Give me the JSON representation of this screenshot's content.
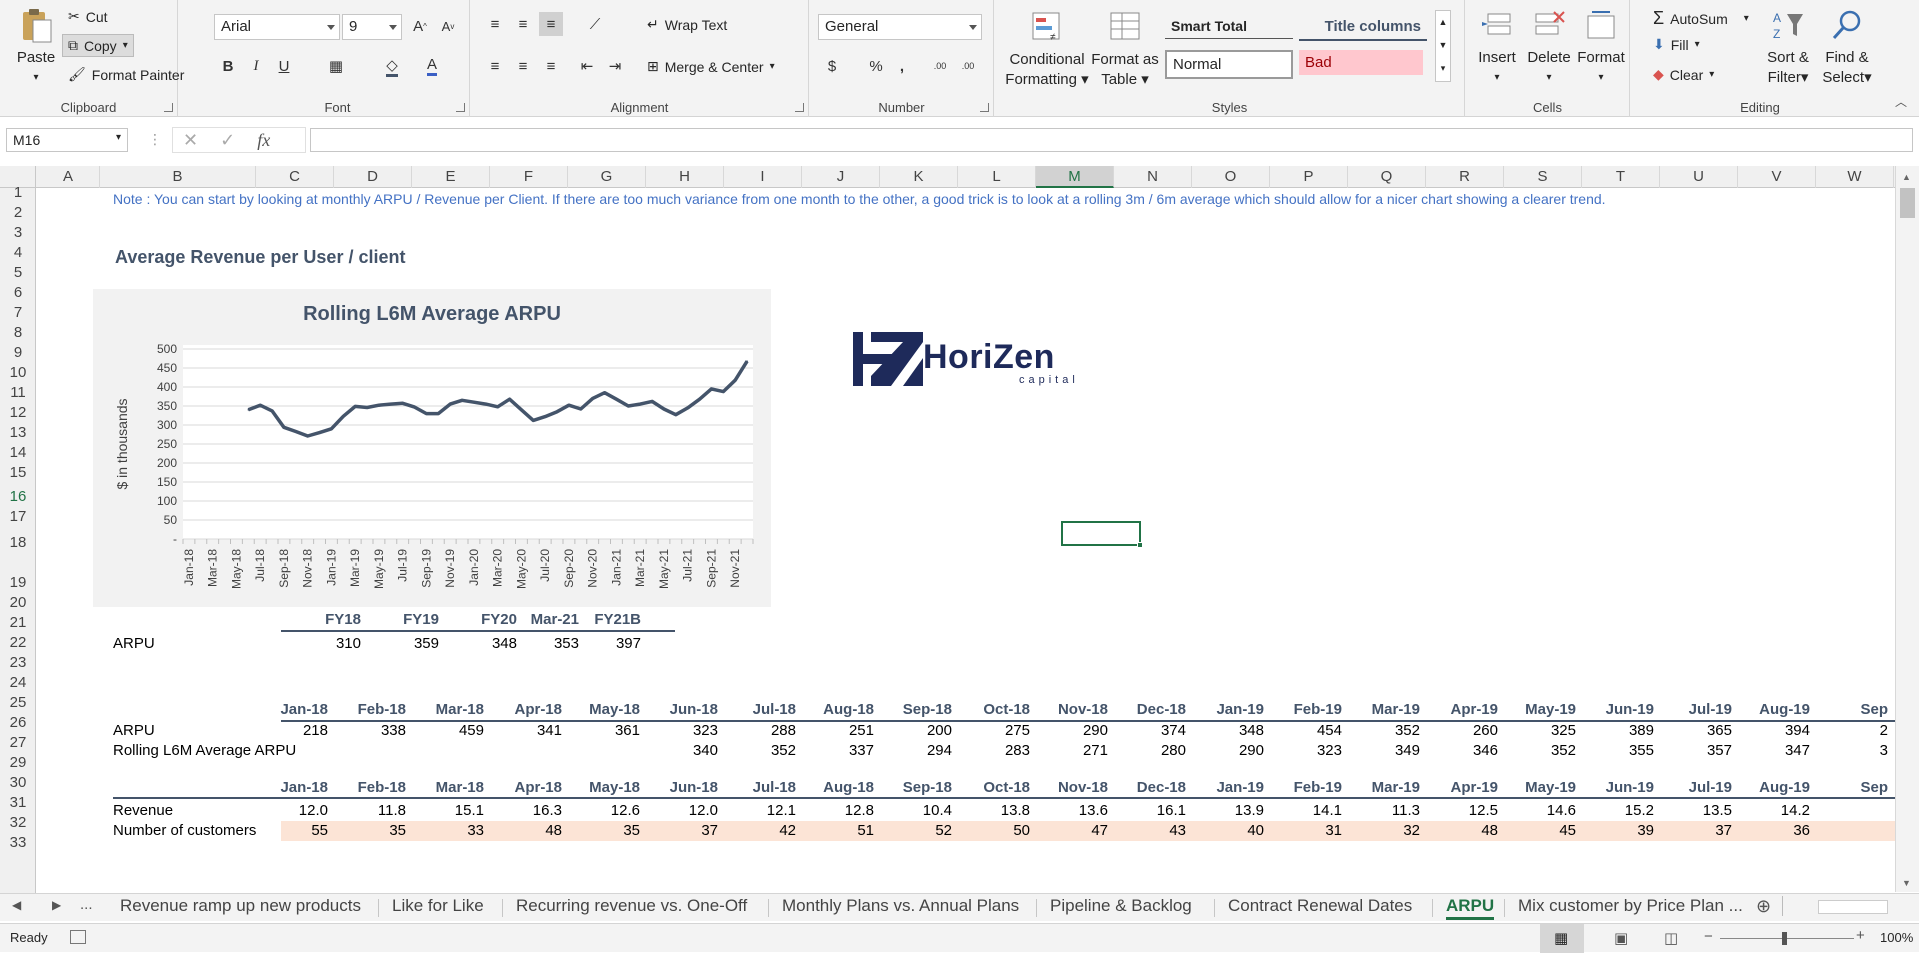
{
  "ribbon": {
    "clipboard": {
      "paste": "Paste",
      "cut": "Cut",
      "copy": "Copy",
      "format_painter": "Format Painter",
      "label": "Clipboard"
    },
    "font": {
      "name": "Arial",
      "size": "9",
      "label": "Font",
      "bold": "B",
      "italic": "I",
      "underline": "U",
      "grow": "A",
      "shrink": "A",
      "font_color": "A"
    },
    "alignment": {
      "wrap": "Wrap Text",
      "merge": "Merge & Center",
      "label": "Alignment"
    },
    "number": {
      "format": "General",
      "percent": "%",
      "comma": ",",
      "inc_decimal": ".00",
      "dec_decimal": ".00",
      "label": "Number"
    },
    "styles": {
      "conditional": "Conditional",
      "conditional2": "Formatting",
      "format_as": "Format as",
      "format_as2": "Table",
      "smart_total": "Smart Total",
      "title_columns": "Title columns",
      "normal": "Normal",
      "bad": "Bad",
      "label": "Styles"
    },
    "cells": {
      "insert": "Insert",
      "delete": "Delete",
      "format": "Format",
      "label": "Cells"
    },
    "editing": {
      "autosum": "AutoSum",
      "fill": "Fill",
      "clear": "Clear",
      "sort": "Sort &",
      "sort2": "Filter",
      "find": "Find &",
      "find2": "Select",
      "label": "Editing"
    }
  },
  "formula_bar": {
    "name_box": "M16",
    "fx": "fx",
    "formula": ""
  },
  "columns": [
    "A",
    "B",
    "C",
    "D",
    "E",
    "F",
    "G",
    "H",
    "I",
    "J",
    "K",
    "L",
    "M",
    "N",
    "O",
    "P",
    "Q",
    "R",
    "S",
    "T",
    "U",
    "V",
    "W"
  ],
  "selected_column": "M",
  "rows": [
    "1",
    "2",
    "3",
    "4",
    "5",
    "6",
    "7",
    "8",
    "9",
    "10",
    "11",
    "12",
    "13",
    "14",
    "15",
    "16",
    "17",
    "18",
    "19",
    "20",
    "21",
    "22",
    "23",
    "24",
    "25",
    "26",
    "27",
    "29",
    "30",
    "31",
    "32",
    "33"
  ],
  "selected_row": "16",
  "sheet": {
    "note": "Note : You can start by looking at monthly ARPU / Revenue per Client. If there are too much variance from one month to the other, a good trick is to look at a rolling 3m / 6m average which should allow for a nicer chart showing a clearer trend.",
    "section_title": "Average Revenue per User / client",
    "logo_text": "HoriZen",
    "logo_sub": "capital",
    "fy_headers": [
      "FY18",
      "FY19",
      "FY20",
      "Mar-21",
      "FY21B"
    ],
    "arpu_label": "ARPU",
    "fy_values": [
      "310",
      "359",
      "348",
      "353",
      "397"
    ],
    "month_headers": [
      "Jan-18",
      "Feb-18",
      "Mar-18",
      "Apr-18",
      "May-18",
      "Jun-18",
      "Jul-18",
      "Aug-18",
      "Sep-18",
      "Oct-18",
      "Nov-18",
      "Dec-18",
      "Jan-19",
      "Feb-19",
      "Mar-19",
      "Apr-19",
      "May-19",
      "Jun-19",
      "Jul-19",
      "Aug-19",
      "Sep"
    ],
    "arpu_row_label": "ARPU",
    "arpu_values": [
      "218",
      "338",
      "459",
      "341",
      "361",
      "323",
      "288",
      "251",
      "200",
      "275",
      "290",
      "374",
      "348",
      "454",
      "352",
      "260",
      "325",
      "389",
      "365",
      "394",
      "2"
    ],
    "rolling_label": "Rolling L6M Average ARPU",
    "rolling_values": [
      "",
      "",
      "",
      "",
      "",
      "340",
      "352",
      "337",
      "294",
      "283",
      "271",
      "280",
      "290",
      "323",
      "349",
      "346",
      "352",
      "355",
      "357",
      "347",
      "3"
    ],
    "revenue_label": "Revenue",
    "revenue_values": [
      "12.0",
      "11.8",
      "15.1",
      "16.3",
      "12.6",
      "12.0",
      "12.1",
      "12.8",
      "10.4",
      "13.8",
      "13.6",
      "16.1",
      "13.9",
      "14.1",
      "11.3",
      "12.5",
      "14.6",
      "15.2",
      "13.5",
      "14.2",
      ""
    ],
    "customers_label": "Number of customers",
    "customers_values": [
      "55",
      "35",
      "33",
      "48",
      "35",
      "37",
      "42",
      "51",
      "52",
      "50",
      "47",
      "43",
      "40",
      "31",
      "32",
      "48",
      "45",
      "39",
      "37",
      "36",
      ""
    ]
  },
  "chart_data": {
    "type": "line",
    "title": "Rolling L6M Average ARPU",
    "ylabel": "$ in thousands",
    "xlabel": "",
    "ylim": [
      0,
      500
    ],
    "yticks": [
      "-",
      "50",
      "100",
      "150",
      "200",
      "250",
      "300",
      "350",
      "400",
      "450",
      "500"
    ],
    "x_tick_labels": [
      "Jan-18",
      "Mar-18",
      "May-18",
      "Jul-18",
      "Sep-18",
      "Nov-18",
      "Jan-19",
      "Mar-19",
      "May-19",
      "Jul-19",
      "Sep-19",
      "Nov-19",
      "Jan-20",
      "Mar-20",
      "May-20",
      "Jul-20",
      "Sep-20",
      "Nov-20",
      "Jan-21",
      "Mar-21",
      "May-21",
      "Jul-21",
      "Sep-21",
      "Nov-21"
    ],
    "categories": [
      "Jan-18",
      "Feb-18",
      "Mar-18",
      "Apr-18",
      "May-18",
      "Jun-18",
      "Jul-18",
      "Aug-18",
      "Sep-18",
      "Oct-18",
      "Nov-18",
      "Dec-18",
      "Jan-19",
      "Feb-19",
      "Mar-19",
      "Apr-19",
      "May-19",
      "Jun-19",
      "Jul-19",
      "Aug-19",
      "Sep-19",
      "Oct-19",
      "Nov-19",
      "Dec-19",
      "Jan-20",
      "Feb-20",
      "Mar-20",
      "Apr-20",
      "May-20",
      "Jun-20",
      "Jul-20",
      "Aug-20",
      "Sep-20",
      "Oct-20",
      "Nov-20",
      "Dec-20",
      "Jan-21",
      "Feb-21",
      "Mar-21",
      "Apr-21",
      "May-21",
      "Jun-21",
      "Jul-21",
      "Aug-21",
      "Sep-21",
      "Oct-21",
      "Nov-21",
      "Dec-21"
    ],
    "values": [
      null,
      null,
      null,
      null,
      null,
      340,
      352,
      337,
      294,
      283,
      271,
      280,
      290,
      323,
      349,
      346,
      352,
      355,
      357,
      347,
      330,
      330,
      355,
      365,
      360,
      355,
      348,
      368,
      340,
      312,
      322,
      335,
      352,
      342,
      370,
      385,
      368,
      350,
      355,
      362,
      342,
      327,
      345,
      368,
      395,
      388,
      418,
      468
    ],
    "grid": true,
    "color": "#44546a"
  },
  "tabs": [
    "Revenue ramp up new products",
    "Like for Like",
    "Recurring revenue vs. One-Off",
    "Monthly Plans vs. Annual Plans",
    "Pipeline & Backlog",
    "Contract Renewal Dates",
    "ARPU",
    "Mix customer by Price Plan ..."
  ],
  "active_tab": "ARPU",
  "status": {
    "ready": "Ready",
    "zoom": "100%"
  }
}
